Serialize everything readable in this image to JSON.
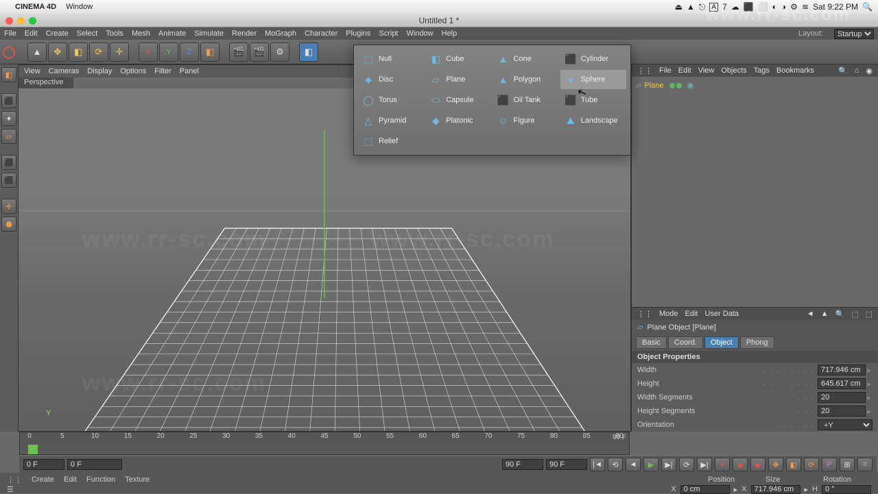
{
  "mac": {
    "app": "CINEMA 4D",
    "menu": "Window",
    "clock": "Sat 9:22 PM"
  },
  "window_title": "Untitled 1 *",
  "menu": [
    "File",
    "Edit",
    "Create",
    "Select",
    "Tools",
    "Mesh",
    "Animate",
    "Simulate",
    "Render",
    "MoGraph",
    "Character",
    "Plugins",
    "Script",
    "Window",
    "Help"
  ],
  "layout": {
    "label": "Layout:",
    "value": "Startup"
  },
  "viewport": {
    "menu": [
      "View",
      "Cameras",
      "Display",
      "Options",
      "Filter",
      "Panel"
    ],
    "label": "Perspective"
  },
  "primitives": [
    {
      "icon": "⬚",
      "name": "Null"
    },
    {
      "icon": "◧",
      "name": "Cube"
    },
    {
      "icon": "▲",
      "name": "Cone"
    },
    {
      "icon": "⬛",
      "name": "Cylinder"
    },
    {
      "icon": "⬥",
      "name": "Disc"
    },
    {
      "icon": "▱",
      "name": "Plane"
    },
    {
      "icon": "▲",
      "name": "Polygon"
    },
    {
      "icon": "●",
      "name": "Sphere"
    },
    {
      "icon": "◯",
      "name": "Torus"
    },
    {
      "icon": "⬭",
      "name": "Capsule"
    },
    {
      "icon": "⬛",
      "name": "Oil Tank"
    },
    {
      "icon": "⬛",
      "name": "Tube"
    },
    {
      "icon": "△",
      "name": "Pyramid"
    },
    {
      "icon": "◆",
      "name": "Platonic"
    },
    {
      "icon": "☺",
      "name": "Figure"
    },
    {
      "icon": "⛰",
      "name": "Landscape"
    },
    {
      "icon": "⬚",
      "name": "Relief"
    }
  ],
  "obj_menu": [
    "File",
    "Edit",
    "View",
    "Objects",
    "Tags",
    "Bookmarks"
  ],
  "obj_item": {
    "name": "Plane"
  },
  "attrib": {
    "menu": [
      "Mode",
      "Edit",
      "User Data"
    ],
    "title": "Plane Object [Plane]",
    "tabs": [
      "Basic",
      "Coord.",
      "Object",
      "Phong"
    ],
    "active_tab": 2,
    "section": "Object Properties",
    "props": [
      {
        "label": "Width",
        "value": "717.946 cm"
      },
      {
        "label": "Height",
        "value": "645.617 cm"
      },
      {
        "label": "Width Segments",
        "value": "20"
      },
      {
        "label": "Height Segments",
        "value": "20"
      }
    ],
    "orientation": {
      "label": "Orientation",
      "value": "+Y"
    }
  },
  "timeline": {
    "ticks": [
      0,
      5,
      10,
      15,
      20,
      25,
      30,
      35,
      40,
      45,
      50,
      55,
      60,
      65,
      70,
      75,
      80,
      85,
      90
    ],
    "start": "0 F",
    "cur": "0 F",
    "end": "90 F",
    "end2": "90 F"
  },
  "coord_heads": [
    "Position",
    "Size",
    "Rotation"
  ],
  "coord_row": {
    "x_lbl": "X",
    "x": "0 cm",
    "x2_lbl": "X",
    "x2": "717.946 cm",
    "h_lbl": "H",
    "h": "0 °"
  },
  "mat_menu": [
    "Create",
    "Edit",
    "Function",
    "Texture"
  ],
  "watermark": "www.rr-sc.com"
}
